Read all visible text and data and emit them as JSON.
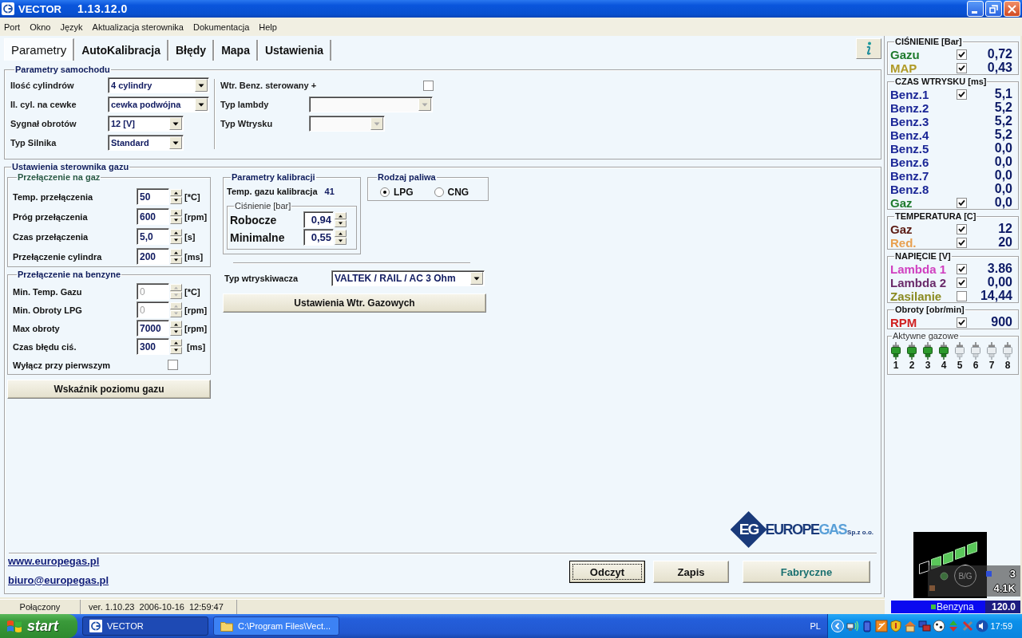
{
  "window": {
    "title": "VECTOR",
    "version": "1.13.12.0"
  },
  "menu": [
    {
      "label": "Port"
    },
    {
      "label": "Okno"
    },
    {
      "label": "Język"
    },
    {
      "label": "Aktualizacja sterownika"
    },
    {
      "label": "Dokumentacja"
    },
    {
      "label": "Help"
    }
  ],
  "tabs": [
    {
      "label": "Parametry",
      "selected": true
    },
    {
      "label": "AutoKalibracja",
      "selected": false
    },
    {
      "label": "Błędy",
      "selected": false
    },
    {
      "label": "Mapa",
      "selected": false
    },
    {
      "label": "Ustawienia",
      "selected": false
    }
  ],
  "car_parameters": {
    "title": "Parametry samochodu",
    "left_fields": [
      {
        "label": "Ilość cylindrów",
        "value": "4 cylindry"
      },
      {
        "label": "Il. cyl. na cewke",
        "value": "cewka podwójna"
      },
      {
        "label": "Sygnał obrotów",
        "value": "12 [V]"
      },
      {
        "label": "Typ Silnika",
        "value": "Standard"
      }
    ],
    "right_fields": [
      {
        "label": "Wtr. Benz. sterowany +",
        "kind": "checkbox",
        "checked": false,
        "disabled": false
      },
      {
        "label": "Typ lambdy",
        "kind": "select",
        "disabled": true
      },
      {
        "label": "Typ Wtrysku",
        "kind": "select",
        "disabled": true
      }
    ]
  },
  "gas_settings": {
    "title": "Ustawienia sterownika gazu",
    "switch_to_gas": {
      "title": "Przełączenie na gaz",
      "fields": [
        {
          "label": "Temp. przełączenia",
          "value": "50",
          "unit": "[*C]"
        },
        {
          "label": "Próg przełączenia",
          "value": "600",
          "unit": "[rpm]"
        },
        {
          "label": "Czas przełączenia",
          "value": "5,0",
          "unit": "[s]"
        },
        {
          "label": "Przełączenie cylindra",
          "value": "200",
          "unit": "[ms]"
        }
      ]
    },
    "switch_to_petrol": {
      "title": "Przełączenie na benzyne",
      "fields": [
        {
          "label": "Min. Temp. Gazu",
          "value": "0",
          "unit": "[*C]",
          "disabled": true
        },
        {
          "label": "Min. Obroty LPG",
          "value": "0",
          "unit": "[rpm]",
          "disabled": true
        },
        {
          "label": "Max obroty",
          "value": "7000",
          "unit": "[rpm]",
          "disabled": false
        },
        {
          "label": "Czas błędu ciś.",
          "value": "300",
          "unit": "[ms]",
          "disabled": false
        }
      ],
      "checkbox": {
        "label": "Wyłącz przy pierwszym",
        "checked": false
      }
    },
    "level_button": {
      "label": "Wskaźnik poziomu gazu"
    },
    "calibration": {
      "title": "Parametry kalibracji",
      "temp_label": "Temp. gazu kalibracja",
      "temp_value": "41",
      "pressure_title": "Ciśnienie [bar]",
      "fields": [
        {
          "label": "Robocze",
          "value": "0,94"
        },
        {
          "label": "Minimalne",
          "value": "0,55"
        }
      ]
    },
    "fuel_type": {
      "title": "Rodzaj paliwa",
      "options": [
        {
          "label": "LPG",
          "selected": true
        },
        {
          "label": "CNG",
          "selected": false
        }
      ]
    },
    "injector_type": {
      "label": "Typ wtryskiwacza",
      "value": "VALTEK / RAIL / AC 3 Ohm"
    },
    "injector_button": {
      "label": "Ustawienia Wtr. Gazowych"
    }
  },
  "logo": {
    "mark": "EG",
    "name_dark": "EUROPE",
    "name_light": "GAS",
    "suffix": "Sp.z o.o."
  },
  "links": [
    {
      "label": "www.europegas.pl"
    },
    {
      "label": "biuro@europegas.pl"
    }
  ],
  "buttons": [
    {
      "label": "Odczyt",
      "focused": true,
      "kind": "action"
    },
    {
      "label": "Zapis",
      "focused": false,
      "kind": "action"
    },
    {
      "label": "Fabryczne",
      "focused": false,
      "kind": "reset"
    }
  ],
  "status_bar": [
    {
      "text": "Połączony"
    },
    {
      "text": "ver. 1.10.23  2006-10-16  12:59:47"
    }
  ],
  "readouts": [
    {
      "title": "CIŚNIENIE [Bar]",
      "rows": [
        {
          "label": "Gazu",
          "color": "#1e7a2c",
          "checked": true,
          "value": "0,72"
        },
        {
          "label": "MAP",
          "color": "#b09a26",
          "checked": true,
          "value": "0,43"
        }
      ]
    },
    {
      "title": "CZAS WTRYSKU [ms]",
      "rows": [
        {
          "label": "Benz.1",
          "color": "#1a2696",
          "checked": true,
          "value": "5,1"
        },
        {
          "label": "Benz.2",
          "color": "#1a2696",
          "value": "5,2"
        },
        {
          "label": "Benz.3",
          "color": "#1a2696",
          "value": "5,2"
        },
        {
          "label": "Benz.4",
          "color": "#1a2696",
          "value": "5,2"
        },
        {
          "label": "Benz.5",
          "color": "#1a2696",
          "value": "0,0"
        },
        {
          "label": "Benz.6",
          "color": "#1a2696",
          "value": "0,0"
        },
        {
          "label": "Benz.7",
          "color": "#1a2696",
          "value": "0,0"
        },
        {
          "label": "Benz.8",
          "color": "#1a2696",
          "value": "0,0"
        },
        {
          "label": "Gaz",
          "color": "#1e7a2c",
          "checked": true,
          "value": "0,0"
        }
      ]
    },
    {
      "title": "TEMPERATURA [C]",
      "rows": [
        {
          "label": "Gaz",
          "color": "#5a1a12",
          "checked": true,
          "value": "12"
        },
        {
          "label": "Red.",
          "color": "#e8a050",
          "checked": true,
          "value": "20"
        }
      ]
    },
    {
      "title": "NAPIĘCIE [V]",
      "rows": [
        {
          "label": "Lambda 1",
          "color": "#d040c0",
          "checked": true,
          "value": "3.86"
        },
        {
          "label": "Lambda 2",
          "color": "#6a2a6a",
          "checked": true,
          "value": "0,00"
        },
        {
          "label": "Zasilanie",
          "color": "#8a8a20",
          "checked": false,
          "value": "14,44"
        }
      ]
    },
    {
      "title": "Obroty [obr/min]",
      "rows": [
        {
          "label": "RPM",
          "color": "#d02020",
          "checked": true,
          "value": "900"
        }
      ]
    }
  ],
  "active_injectors": {
    "title": "Aktywne gazowe",
    "items": [
      {
        "label": "1",
        "on": true
      },
      {
        "label": "2",
        "on": true
      },
      {
        "label": "3",
        "on": true
      },
      {
        "label": "4",
        "on": true
      },
      {
        "label": "5",
        "on": false
      },
      {
        "label": "6",
        "on": false
      },
      {
        "label": "7",
        "on": false
      },
      {
        "label": "8",
        "on": false
      }
    ]
  },
  "gas_gauge": {
    "segments": [
      {
        "on": false
      },
      {
        "on": true
      },
      {
        "on": true
      },
      {
        "on": true
      },
      {
        "on": true
      }
    ],
    "mode": "B/G",
    "top_value": "3",
    "bottom_value": "4.1K",
    "fuel": "Benzyna",
    "reading": "120.0"
  },
  "taskbar": {
    "start": "start",
    "tasks": [
      {
        "label": "VECTOR",
        "selected": true,
        "kind": "app"
      },
      {
        "label": "C:\\Program Files\\Vect...",
        "selected": false,
        "kind": "folder"
      }
    ],
    "language": "PL",
    "clock": "17:59"
  }
}
